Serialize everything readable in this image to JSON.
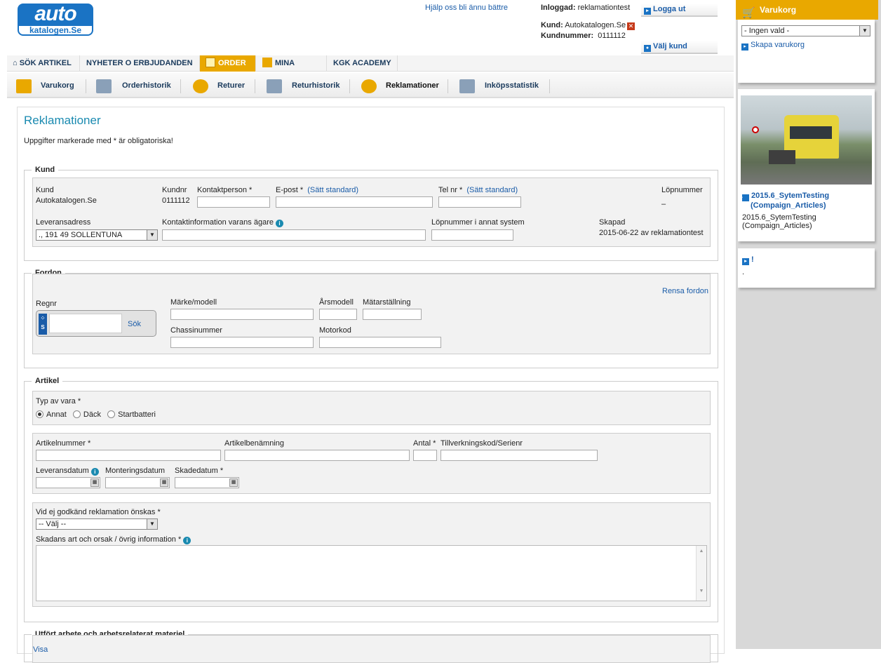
{
  "header": {
    "logo_top": "auto",
    "logo_bottom": "katalogen.Se",
    "help_link": "Hjälp oss bli ännu bättre",
    "logged_in_label": "Inloggad:",
    "logged_in_user": "reklamationtest",
    "customer_label": "Kund:",
    "customer_value": "Autokatalogen.Se",
    "custno_label": "Kundnummer:",
    "custno_value": "0111112",
    "logout": "Logga ut",
    "choose_customer": "Välj kund"
  },
  "nav_main": [
    "SÖK ARTIKEL",
    "NYHETER O ERBJUDANDEN",
    "ORDER",
    "MINA SIDOR",
    "KGK ACADEMY"
  ],
  "nav_sub": [
    "Varukorg",
    "Orderhistorik",
    "Returer",
    "Returhistorik",
    "Reklamationer",
    "Inköpsstatistik"
  ],
  "page": {
    "title": "Reklamationer",
    "required_note": "Uppgifter markerade med * är obligatoriska!"
  },
  "kund": {
    "legend": "Kund",
    "kund_label": "Kund",
    "kund_value": "Autokatalogen.Se",
    "kundnr_label": "Kundnr",
    "kundnr_value": "0111112",
    "contact_label": "Kontaktperson *",
    "email_label": "E-post *",
    "set_default": "(Sätt standard)",
    "tel_label": "Tel nr *",
    "lopnummer_label": "Löpnummer",
    "lopnummer_value": "–",
    "delivery_label": "Leveransadress",
    "delivery_value": "., 191 49 SOLLENTUNA",
    "owner_contact_label": "Kontaktinformation varans ägare",
    "other_lopnr_label": "Löpnummer i annat system",
    "created_label": "Skapad",
    "created_value": "2015-06-22 av reklamationtest"
  },
  "fordon": {
    "legend": "Fordon",
    "clear": "Rensa fordon",
    "regnr_label": "Regnr",
    "plate_country": "S",
    "search": "Sök",
    "make_label": "Märke/modell",
    "year_label": "Årsmodell",
    "odometer_label": "Mätarställning",
    "chassis_label": "Chassinummer",
    "engine_label": "Motorkod"
  },
  "artikel": {
    "legend": "Artikel",
    "type_label": "Typ av vara *",
    "types": [
      "Annat",
      "Däck",
      "Startbatteri"
    ],
    "selected_type": "Annat",
    "artnr_label": "Artikelnummer *",
    "artname_label": "Artikelbenämning",
    "qty_label": "Antal *",
    "serial_label": "Tillverkningskod/Serienr",
    "delivery_date_label": "Leveransdatum",
    "mount_date_label": "Monteringsdatum",
    "damage_date_label": "Skadedatum *",
    "if_rejected_label": "Vid ej godkänd reklamation önskas *",
    "if_rejected_value": "-- Välj --",
    "damage_info_label": "Skadans art och orsak / övrig information *"
  },
  "work": {
    "legend": "Utfört arbete och arbetsrelaterat materiel",
    "show": "Visa"
  },
  "sidebar": {
    "cart_title": "Varukorg",
    "cart_select": "- Ingen vald -",
    "create_cart": "Skapa varukorg",
    "news_link": "2015.6_SytemTesting (Compaign_Articles)",
    "news_text": "2015.6_SytemTesting (Compaign_Articles)",
    "box2_title": "!",
    "box2_text": "."
  },
  "colors": {
    "accent_orange": "#e9a800",
    "link_blue": "#1a5ca8",
    "title_teal": "#1a8ab0"
  }
}
